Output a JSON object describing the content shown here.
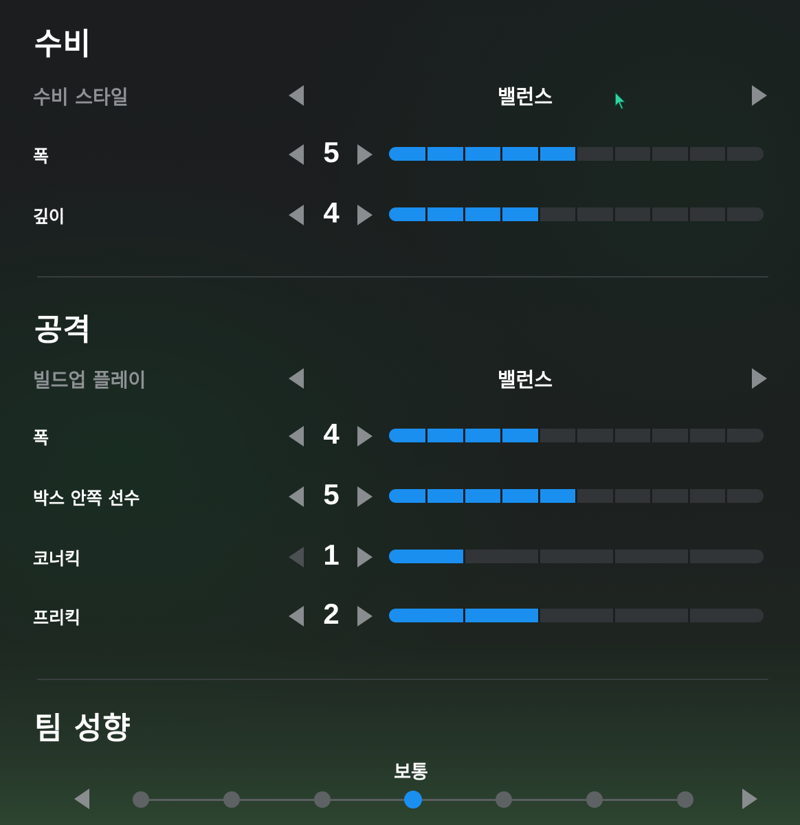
{
  "defense": {
    "title": "수비",
    "style_label": "수비 스타일",
    "style_value": "밸런스",
    "rows": [
      {
        "label": "폭",
        "value": "5",
        "level": 5,
        "max": 10
      },
      {
        "label": "깊이",
        "value": "4",
        "level": 4,
        "max": 10
      }
    ]
  },
  "attack": {
    "title": "공격",
    "style_label": "빌드업 플레이",
    "style_value": "밸런스",
    "rows": [
      {
        "label": "폭",
        "value": "4",
        "level": 4,
        "max": 10
      },
      {
        "label": "박스 안쪽 선수",
        "value": "5",
        "level": 5,
        "max": 10
      },
      {
        "label": "코너킥",
        "value": "1",
        "level": 1,
        "max": 5
      },
      {
        "label": "프리킥",
        "value": "2",
        "level": 2,
        "max": 5
      }
    ]
  },
  "tendency": {
    "title": "팀 성향",
    "value_label": "보통",
    "steps": 7,
    "selected_index": 3
  },
  "colors": {
    "accent": "#1a8ff0",
    "bar_empty": "#323537"
  },
  "icons": {
    "prev": "triangle-left-icon",
    "next": "triangle-right-icon",
    "cursor": "mouse-pointer-icon"
  }
}
